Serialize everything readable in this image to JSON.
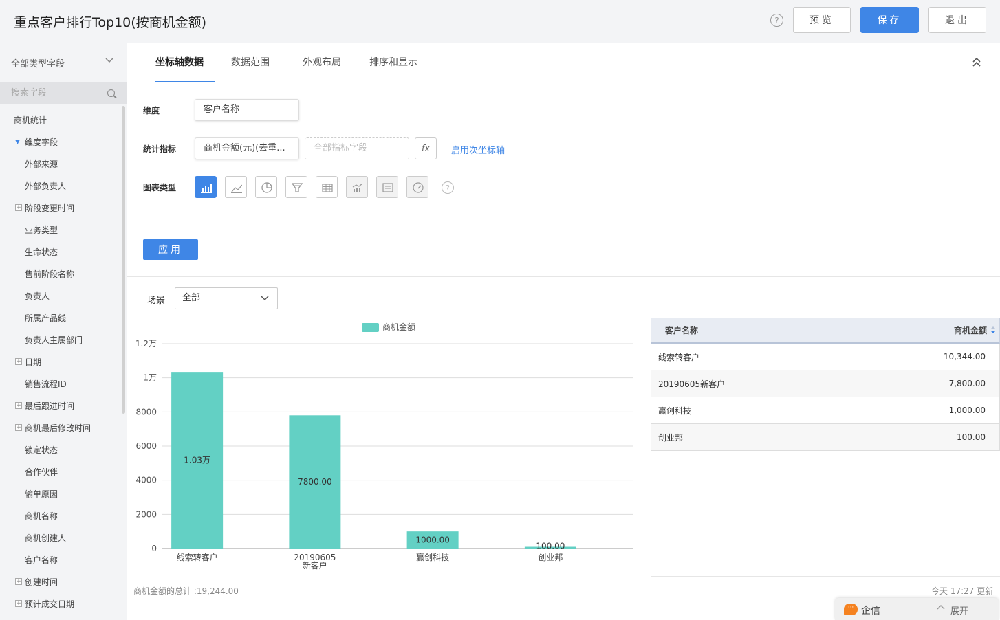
{
  "header": {
    "title": "重点客户排行Top10(按商机金额)",
    "help": "?",
    "preview": "预览",
    "save": "保存",
    "exit": "退出"
  },
  "sidebar": {
    "field_type": "全部类型字段",
    "search_placeholder": "搜索字段",
    "items": [
      {
        "label": "商机统计",
        "kind": "root"
      },
      {
        "label": "维度字段",
        "kind": "open"
      },
      {
        "label": "外部来源",
        "kind": "leaf"
      },
      {
        "label": "外部负责人",
        "kind": "leaf"
      },
      {
        "label": "阶段变更时间",
        "kind": "group"
      },
      {
        "label": "业务类型",
        "kind": "leaf"
      },
      {
        "label": "生命状态",
        "kind": "leaf"
      },
      {
        "label": "售前阶段名称",
        "kind": "leaf"
      },
      {
        "label": "负责人",
        "kind": "leaf"
      },
      {
        "label": "所属产品线",
        "kind": "leaf"
      },
      {
        "label": "负责人主属部门",
        "kind": "leaf"
      },
      {
        "label": "日期",
        "kind": "group"
      },
      {
        "label": "销售流程ID",
        "kind": "leaf"
      },
      {
        "label": "最后跟进时间",
        "kind": "group"
      },
      {
        "label": "商机最后修改时间",
        "kind": "group"
      },
      {
        "label": "锁定状态",
        "kind": "leaf"
      },
      {
        "label": "合作伙伴",
        "kind": "leaf"
      },
      {
        "label": "输单原因",
        "kind": "leaf"
      },
      {
        "label": "商机名称",
        "kind": "leaf"
      },
      {
        "label": "商机创建人",
        "kind": "leaf"
      },
      {
        "label": "客户名称",
        "kind": "leaf"
      },
      {
        "label": "创建时间",
        "kind": "group"
      },
      {
        "label": "预计成交日期",
        "kind": "group"
      }
    ]
  },
  "tabs": [
    {
      "label": "坐标轴数据",
      "active": true
    },
    {
      "label": "数据范围",
      "active": false
    },
    {
      "label": "外观布局",
      "active": false
    },
    {
      "label": "排序和显示",
      "active": false
    }
  ],
  "config": {
    "dimension_label": "维度",
    "dimension_value": "客户名称",
    "indicator_label": "统计指标",
    "indicator_value": "商机金额(元)(去重...",
    "indicator_placeholder": "全部指标字段",
    "fx": "fx",
    "secondary_axis": "启用次坐标轴",
    "chart_type_label": "图表类型",
    "chart_type_help": "?",
    "apply": "应用"
  },
  "chart_types": [
    {
      "icon": "bar-chart-icon",
      "state": "active"
    },
    {
      "icon": "line-chart-icon",
      "state": "normal"
    },
    {
      "icon": "pie-chart-icon",
      "state": "normal"
    },
    {
      "icon": "funnel-chart-icon",
      "state": "normal"
    },
    {
      "icon": "table-chart-icon",
      "state": "normal"
    },
    {
      "icon": "combo-chart-icon",
      "state": "disabled"
    },
    {
      "icon": "card-chart-icon",
      "state": "disabled"
    },
    {
      "icon": "gauge-chart-icon",
      "state": "disabled"
    }
  ],
  "scene": {
    "label": "场景",
    "value": "全部"
  },
  "chart_data": {
    "type": "bar",
    "legend": "商机金额",
    "legend_position": "top-center",
    "categories": [
      "线索转客户",
      "20190605新客户",
      "赢创科技",
      "创业邦"
    ],
    "values": [
      10344,
      7800,
      1000,
      100
    ],
    "data_labels": [
      "1.03万",
      "7800.00",
      "1000.00",
      "100.00"
    ],
    "ylim": [
      0,
      12000
    ],
    "yticks": [
      0,
      2000,
      4000,
      6000,
      8000,
      10000,
      12000
    ],
    "ytick_labels": [
      "0",
      "2000",
      "4000",
      "6000",
      "8000",
      "1万",
      "1.2万"
    ],
    "grid": true,
    "color": "#63d0c4"
  },
  "total_text": "商机金额的总计 :19,244.00",
  "table": {
    "headers": [
      "客户名称",
      "商机金额"
    ],
    "rows": [
      [
        "线索转客户",
        "10,344.00"
      ],
      [
        "20190605新客户",
        "7,800.00"
      ],
      [
        "赢创科技",
        "1,000.00"
      ],
      [
        "创业邦",
        "100.00"
      ]
    ]
  },
  "updated_text": "今天 17:27 更新",
  "chat": {
    "name": "企信",
    "expand": "展开"
  }
}
